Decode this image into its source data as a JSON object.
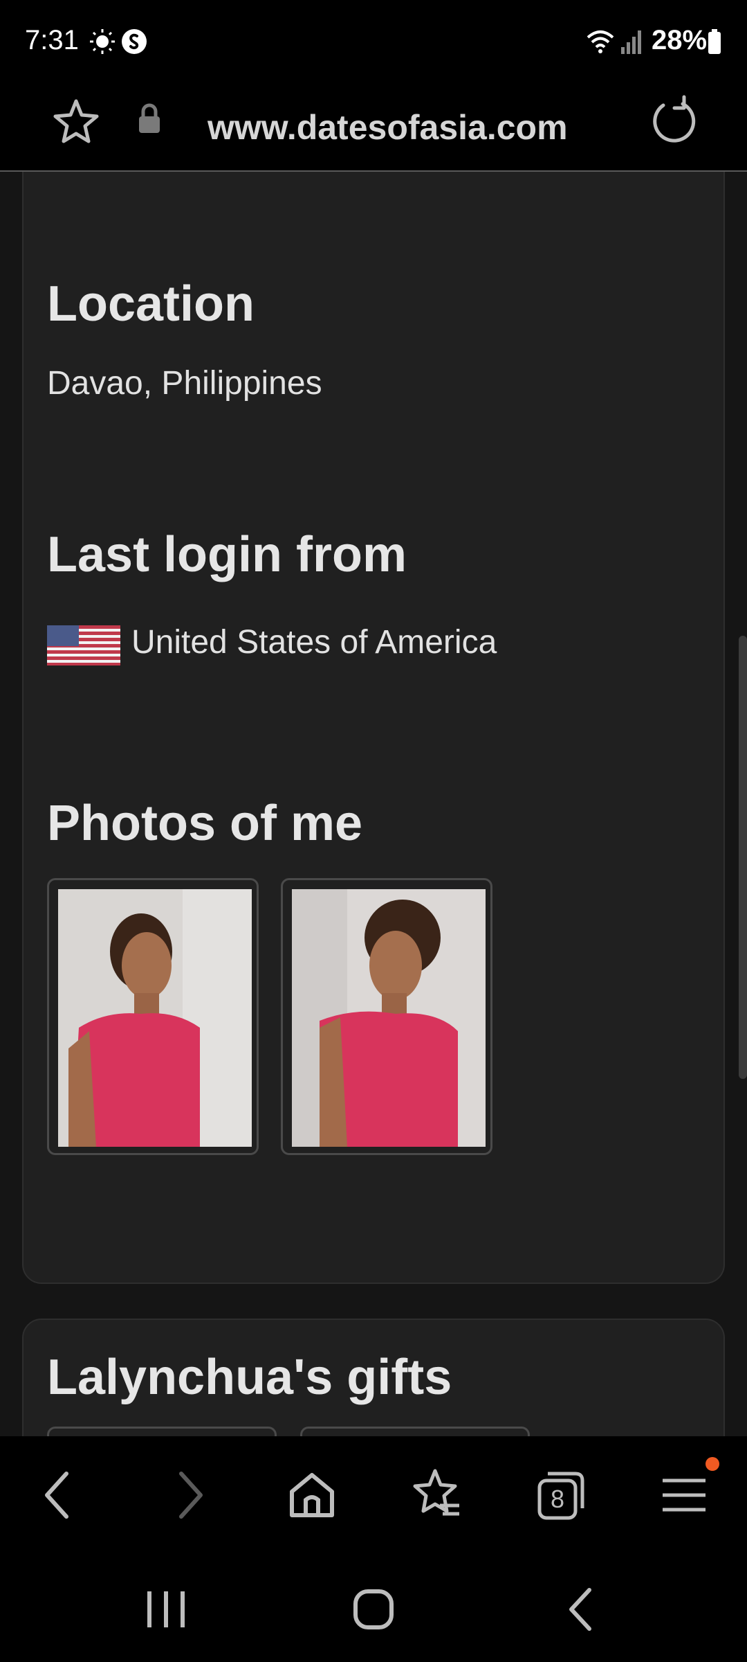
{
  "status": {
    "time": "7:31",
    "battery": "28%"
  },
  "browser": {
    "url": "www.datesofasia.com",
    "tab_count": "8"
  },
  "profile": {
    "location_heading": "Location",
    "location_value": "Davao, Philippines",
    "last_login_heading": "Last login from",
    "last_login_country": "United States of America",
    "photos_heading": "Photos of me",
    "gifts_heading": "Lalynchua's gifts"
  },
  "icons": {
    "status": [
      "brightness-icon",
      "shazam-icon",
      "wifi-icon",
      "signal-icon",
      "battery-icon"
    ],
    "toolbar": [
      "bookmark-star-icon",
      "lock-icon",
      "reload-icon"
    ],
    "bottom_nav": [
      "back-icon",
      "forward-icon",
      "home-icon",
      "bookmarks-icon",
      "tabs-icon",
      "menu-icon"
    ],
    "system_nav": [
      "recents-icon",
      "home-circle-icon",
      "system-back-icon"
    ]
  },
  "colors": {
    "accent_dot": "#f05a22",
    "card_bg": "#202020",
    "page_bg": "#151515"
  }
}
